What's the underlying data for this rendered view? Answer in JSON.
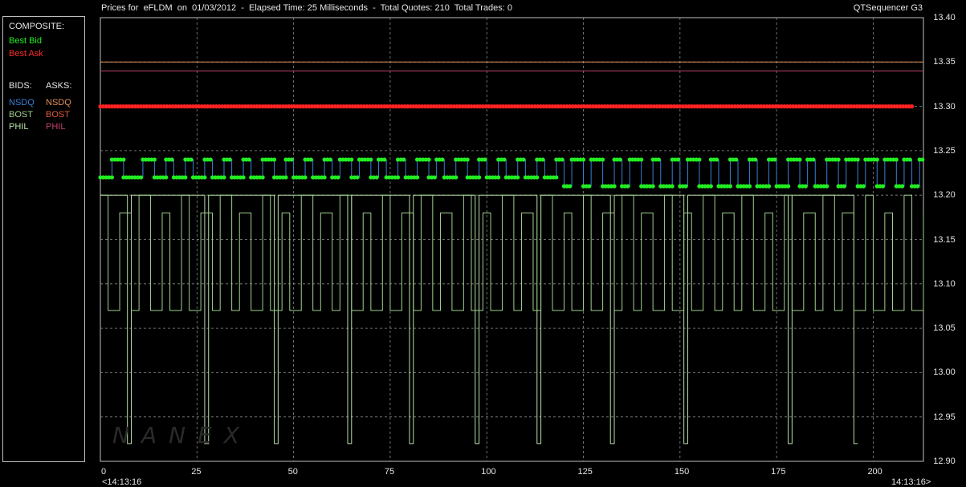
{
  "header": {
    "title": "Prices for  eFLDM  on  01/03/2012  -  Elapsed Time: 25 Milliseconds  -  Total Quotes: 210  Total Trades: 0",
    "app": "QTSequencer G3"
  },
  "legend": {
    "composite_label": "COMPOSITE:",
    "best_bid": "Best Bid",
    "best_ask": "Best Ask",
    "bids_label": "BIDS:",
    "asks_label": "ASKS:",
    "bid_nsdq": "NSDQ",
    "bid_bost": "BOST",
    "bid_phil": "PHIL",
    "ask_nsdq": "NSDQ",
    "ask_bost": "BOST",
    "ask_phil": "PHIL"
  },
  "watermark": "NANEX",
  "colors": {
    "best_bid": "#22ee22",
    "best_ask": "#ff2222",
    "nsdq_bid": "#3a7fd5",
    "bost_bid": "#9fd08f",
    "phil_bid": "#b8e0a8",
    "nsdq_ask": "#e0905a",
    "bost_ask": "#e05a3a",
    "phil_ask": "#c04070",
    "grid": "#8a8a8a",
    "frame": "#bfbfbf"
  },
  "time_labels": {
    "start": "<14:13:16",
    "end": "14:13:16>"
  },
  "chart_data": {
    "type": "line",
    "title": "Prices for eFLDM on 01/03/2012",
    "xlabel": "",
    "ylabel": "",
    "xlim": [
      0,
      213
    ],
    "ylim": [
      12.9,
      13.4
    ],
    "x_ticks": [
      0,
      25,
      50,
      75,
      100,
      125,
      150,
      175,
      200
    ],
    "y_ticks": [
      "13.40",
      "13.35",
      "13.30",
      "13.25",
      "13.20",
      "13.15",
      "13.10",
      "13.05",
      "13.00",
      "12.95",
      "12.90"
    ],
    "grid": true,
    "legend_position": "left-panel",
    "series": [
      {
        "name": "Best Ask",
        "style": "dots",
        "constant": 13.3,
        "x_range": [
          0,
          210
        ]
      },
      {
        "name": "NSDQ ASK",
        "style": "line",
        "constant": 13.35
      },
      {
        "name": "BOST ASK",
        "style": "line",
        "constant": 13.34
      },
      {
        "name": "Best Bid",
        "style": "dots+step",
        "levels": [
          13.22,
          13.24,
          13.22,
          13.24,
          13.22,
          13.24,
          13.22,
          13.24,
          13.22,
          13.24,
          13.22,
          13.24,
          13.22,
          13.24,
          13.22,
          13.24,
          13.22,
          13.24,
          13.22,
          13.24,
          13.22,
          13.24,
          13.22,
          13.24,
          13.22,
          13.24,
          13.22,
          13.24,
          13.22,
          13.24,
          13.22,
          13.24,
          13.22,
          13.24,
          13.22,
          13.24,
          13.22,
          13.24,
          13.22,
          13.24,
          13.22,
          13.24,
          13.22,
          13.24,
          13.22,
          13.24,
          13.21,
          13.24,
          13.21,
          13.24,
          13.21,
          13.24,
          13.21,
          13.24,
          13.21,
          13.24,
          13.21,
          13.24,
          13.21,
          13.24,
          13.21,
          13.24,
          13.21,
          13.24,
          13.21,
          13.24,
          13.21,
          13.24,
          13.21,
          13.24,
          13.21,
          13.24,
          13.21,
          13.24,
          13.21,
          13.24,
          13.21,
          13.24,
          13.21,
          13.24,
          13.21,
          13.24,
          13.21,
          13.24,
          13.21,
          13.24,
          13.21,
          13.24,
          13.21,
          13.24
        ],
        "x_breaks": [
          0,
          3,
          6,
          11,
          14,
          17,
          19,
          22,
          24,
          27,
          29,
          32,
          34,
          37,
          39,
          42,
          45,
          48,
          50,
          53,
          55,
          58,
          60,
          62,
          65,
          67,
          70,
          72,
          74,
          77,
          79,
          82,
          85,
          87,
          89,
          92,
          95,
          98,
          100,
          103,
          105,
          108,
          110,
          113,
          115,
          118,
          120,
          122,
          125,
          127,
          130,
          133,
          135,
          137,
          140,
          143,
          145,
          148,
          150,
          152,
          155,
          158,
          160,
          163,
          165,
          168,
          170,
          173,
          175,
          178,
          181,
          183,
          185,
          188,
          191,
          193,
          196,
          198,
          201,
          203,
          206,
          208,
          210,
          212
        ]
      },
      {
        "name": "BOST BID",
        "style": "step",
        "levels": [
          13.2,
          13.07,
          13.18,
          13.07,
          13.2,
          13.07,
          13.18,
          13.07,
          13.2,
          13.07,
          13.18,
          13.07,
          13.2,
          13.07,
          13.18,
          13.07,
          13.2,
          13.07,
          13.18,
          13.07,
          13.2,
          13.07,
          13.18,
          13.07,
          13.2,
          13.07,
          13.18,
          13.07,
          13.2,
          13.07,
          13.18,
          13.07,
          13.2,
          13.07,
          13.18,
          13.07,
          13.2,
          13.07,
          13.18,
          13.07,
          13.2,
          13.07,
          13.18,
          13.07,
          13.2,
          13.07,
          13.18,
          13.07,
          13.2,
          13.07,
          13.18,
          13.07,
          13.2,
          13.07,
          13.18,
          13.07,
          13.2,
          13.07,
          13.18,
          13.07,
          13.2,
          13.07,
          13.18,
          13.07,
          13.2,
          13.07,
          13.18,
          13.07,
          13.2,
          13.07,
          13.18,
          13.07,
          13.2,
          13.07,
          13.18,
          13.07,
          13.2,
          13.07,
          13.18,
          13.07,
          13.2,
          13.07,
          13.18,
          13.07
        ],
        "x_breaks": [
          0,
          2,
          5,
          8,
          10,
          13,
          16,
          18,
          21,
          23,
          26,
          29,
          31,
          34,
          36,
          39,
          42,
          44,
          47,
          49,
          52,
          55,
          57,
          60,
          62,
          65,
          68,
          70,
          73,
          75,
          78,
          81,
          83,
          86,
          88,
          91,
          94,
          96,
          99,
          101,
          104,
          107,
          109,
          112,
          114,
          117,
          120,
          122,
          125,
          127,
          130,
          133,
          135,
          138,
          140,
          143,
          146,
          148,
          151,
          153,
          156,
          159,
          161,
          164,
          166,
          169,
          172,
          174,
          177,
          179,
          182,
          185,
          187,
          190,
          192,
          195,
          198,
          200,
          203,
          205,
          208,
          210,
          213
        ]
      },
      {
        "name": "PHIL BID",
        "style": "step",
        "levels": [
          13.2,
          12.92,
          13.2,
          12.92,
          13.2,
          12.92,
          13.2,
          12.92,
          13.2,
          12.92,
          13.2,
          12.92,
          13.2,
          12.92,
          13.2,
          12.92,
          13.2,
          12.92,
          13.2,
          12.92,
          13.2,
          12.92
        ],
        "x_breaks": [
          0,
          7,
          8,
          27,
          28,
          45,
          46,
          64,
          65,
          80,
          81,
          97,
          98,
          113,
          114,
          132,
          133,
          151,
          152,
          178,
          179,
          195,
          196,
          213
        ]
      }
    ]
  }
}
